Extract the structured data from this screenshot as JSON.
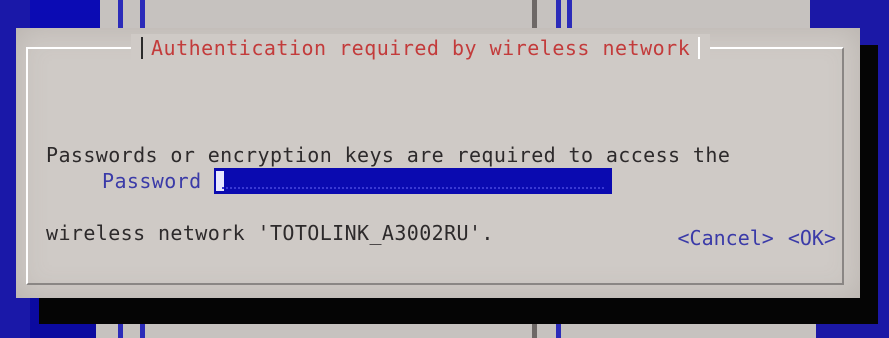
{
  "dialog": {
    "title": "Authentication required by wireless network",
    "message_line_1": "Passwords or encryption keys are required to access the",
    "message_line_2": "wireless network 'TOTOLINK_A3002RU'.",
    "password_label": "Password",
    "password_value": "",
    "cancel_label": "<Cancel>",
    "ok_label": "<OK>"
  },
  "colors": {
    "background": "#0a0aa8",
    "dialog": "#cfcac6",
    "title": "#c33b3b",
    "label": "#3a3aa8",
    "input": "#0a0ab0",
    "text": "#2d2a2b"
  }
}
